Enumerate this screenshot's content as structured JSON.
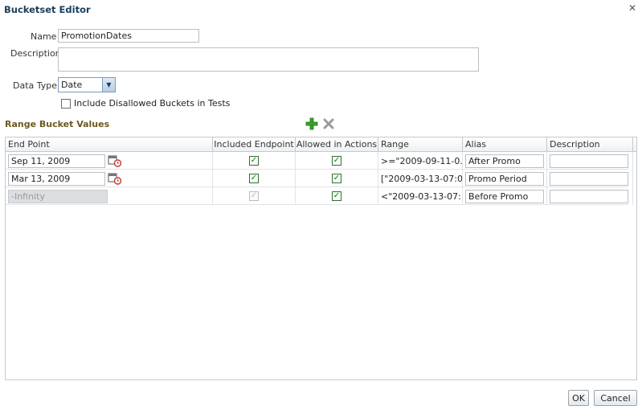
{
  "dialog": {
    "title": "Bucketset Editor",
    "close_icon": "close-icon"
  },
  "form": {
    "name_label": "Name",
    "name_value": "PromotionDates",
    "description_label": "Description",
    "description_value": "",
    "data_type_label": "Data Type",
    "data_type_value": "Date",
    "include_disallowed_label": "Include Disallowed Buckets in Tests",
    "include_disallowed_checked": false
  },
  "range_section": {
    "title": "Range Bucket Values",
    "add_icon": "add-icon",
    "remove_icon": "remove-icon"
  },
  "table": {
    "columns": [
      "End Point",
      "Included Endpoint",
      "Allowed in Actions",
      "Range",
      "Alias",
      "Description"
    ],
    "rows": [
      {
        "end_point": "Sep 11, 2009",
        "end_point_disabled": false,
        "included_endpoint": true,
        "allowed_in_actions": true,
        "range": ">=\"2009-09-11-0...",
        "alias": "After Promo",
        "description": ""
      },
      {
        "end_point": "Mar 13, 2009",
        "end_point_disabled": false,
        "included_endpoint": true,
        "allowed_in_actions": true,
        "range": "[\"2009-03-13-07:0...",
        "alias": "Promo Period",
        "description": ""
      },
      {
        "end_point": "-Infinity",
        "end_point_disabled": true,
        "included_endpoint": true,
        "allowed_in_actions": true,
        "range": "<\"2009-03-13-07:...",
        "alias": "Before Promo",
        "description": ""
      }
    ]
  },
  "footer": {
    "ok_label": "OK",
    "cancel_label": "Cancel"
  }
}
